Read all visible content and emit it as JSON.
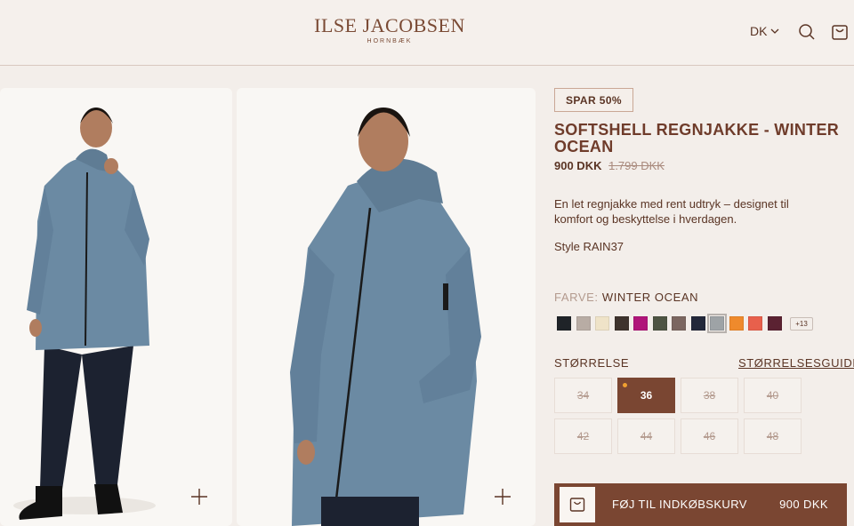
{
  "header": {
    "brand": "ILSE JACOBSEN",
    "brand_sub": "HORNBÆK",
    "language": "DK"
  },
  "icons": [
    "chevron-down-icon",
    "search-icon",
    "cart-icon",
    "plus-icon",
    "bag-icon"
  ],
  "product": {
    "badge": "SPAR 50%",
    "title": "SOFTSHELL REGNJAKKE - WINTER OCEAN",
    "price": "900 DKK",
    "old_price": "1.799 DKK",
    "description": "En let regnjakke med rent udtryk – designet til komfort og beskyttelse i hverdagen.",
    "style": "Style RAIN37"
  },
  "color": {
    "label": "FARVE:",
    "value": "WINTER OCEAN",
    "swatches": [
      "#1f2328",
      "#b8aca4",
      "#efe3c8",
      "#3e332d",
      "#b0157a",
      "#4e5443",
      "#7b6660",
      "#23283a",
      "#9ea3a6",
      "#ef8a2c",
      "#e8604c",
      "#5b2232"
    ],
    "selected_index": 8,
    "more": "+13"
  },
  "size": {
    "label": "STØRRELSE",
    "guide": "STØRRELSESGUIDE",
    "options": [
      "34",
      "36",
      "38",
      "40",
      "42",
      "44",
      "46",
      "48"
    ],
    "selected": "36"
  },
  "cta": {
    "label": "FØJ TIL INDKØBSKURV",
    "price": "900 DKK"
  },
  "colors": {
    "brand": "#7a4632",
    "background": "#f3eeea",
    "jacket": "#6b8aa3"
  }
}
